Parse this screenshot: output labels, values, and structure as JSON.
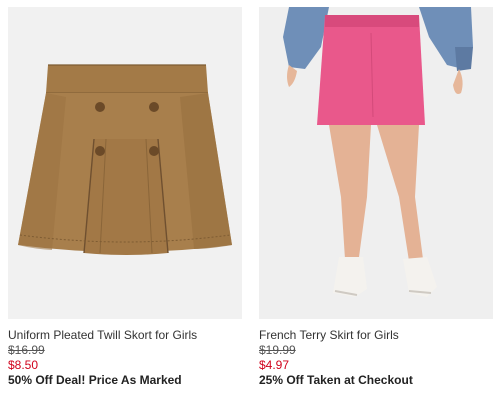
{
  "products": [
    {
      "image_alt": "skort-photo",
      "title": "Uniform Pleated Twill Skort for Girls",
      "original_price": "$16.99",
      "sale_price": "$8.50",
      "promo": "50% Off Deal! Price As Marked"
    },
    {
      "image_alt": "skirt-photo",
      "title": "French Terry Skirt for Girls",
      "original_price": "$19.99",
      "sale_price": "$4.97",
      "promo": "25% Off Taken at Checkout"
    }
  ],
  "colors": {
    "sale_price": "#d0021b",
    "text": "#333333",
    "image_bg": "#f0f0f0",
    "skort": "#a47c4a",
    "skirt": "#ea5a8c"
  }
}
